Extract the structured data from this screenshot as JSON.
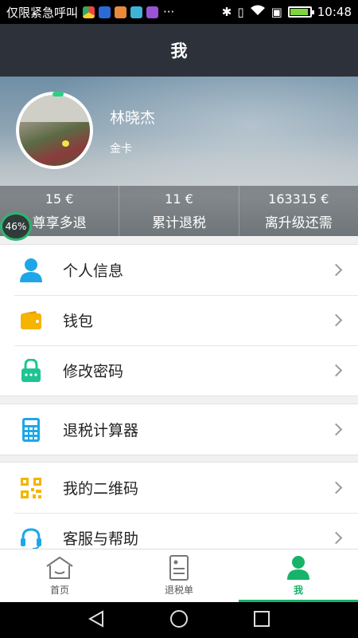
{
  "status_bar": {
    "carrier": "仅限紧急呼叫",
    "overflow": "···",
    "time": "10:48",
    "battery_level": 0.85
  },
  "title_bar": {
    "title": "我"
  },
  "profile": {
    "name": "林晓杰",
    "membership": "金卡",
    "progress_percent": "46%",
    "stats": [
      {
        "value": "15 €",
        "label": "尊享多退"
      },
      {
        "value": "11 €",
        "label": "累计退税"
      },
      {
        "value": "163315 €",
        "label": "离升级还需"
      }
    ]
  },
  "menu": {
    "group1": [
      {
        "label": "个人信息",
        "icon": "person-icon",
        "color": "#1ea7e8"
      },
      {
        "label": "钱包",
        "icon": "wallet-icon",
        "color": "#f5b400"
      },
      {
        "label": "修改密码",
        "icon": "lock-icon",
        "color": "#1ec494"
      }
    ],
    "group2": [
      {
        "label": "退税计算器",
        "icon": "calculator-icon",
        "color": "#1ea7e8"
      }
    ],
    "group3": [
      {
        "label": "我的二维码",
        "icon": "qrcode-icon",
        "color": "#f5b400"
      },
      {
        "label": "客服与帮助",
        "icon": "headset-icon",
        "color": "#1ea7e8"
      }
    ]
  },
  "tabbar": {
    "tabs": [
      {
        "label": "首页",
        "icon": "home-icon"
      },
      {
        "label": "退税单",
        "icon": "document-icon"
      },
      {
        "label": "我",
        "icon": "person-icon",
        "active": true
      }
    ],
    "accent": "#17b36a"
  }
}
